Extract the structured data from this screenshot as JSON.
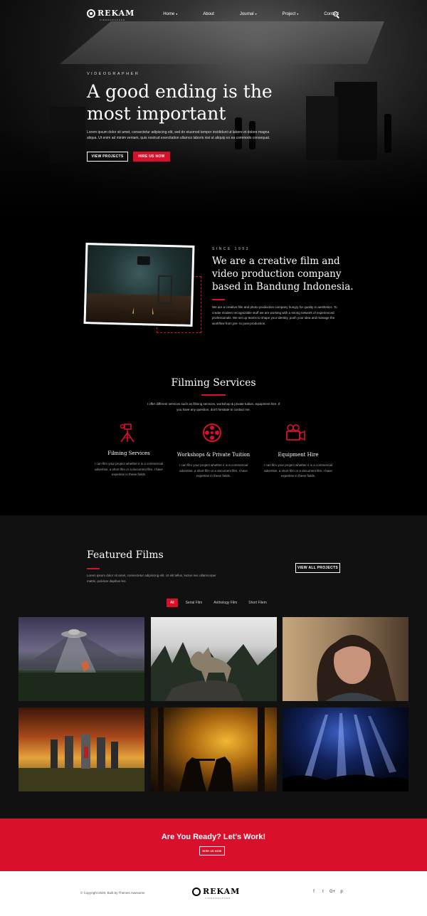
{
  "brand": {
    "name": "REKAM",
    "tagline": "VIDEOGRAPHER"
  },
  "nav": {
    "items": [
      "Home",
      "About",
      "Journal",
      "Project",
      "Contact"
    ],
    "caret": "▾"
  },
  "hero": {
    "eyebrow": "VIDEOGRAPHER",
    "title": "A good ending is the most important",
    "text": "Lorem ipsum dolor sit amet, consectetur adipiscing elit, sed do eiusmod tempor incididunt ut labore et dolore magna aliqua. Ut enim ad minim veniam, quis nostrud exercitation ullamco laboris nisi ut aliquip ex ea commodo consequat.",
    "btn_projects": "VIEW PROJECTS",
    "btn_hire": "HIRE US NOW"
  },
  "about": {
    "since": "SINCE 1993",
    "title": "We are a creative film and video production company based in Bandung Indonesia.",
    "text": "We are a creative film and photo production company hungry for quality in aesthetics. To create modern recognizable stuff we are working with a strong network of experienced professionals. We set up teams to shape your identity, push your idea and manage the workflow from pre- to post-production."
  },
  "services": {
    "title": "Filming Services",
    "subtitle": "I offer different services such as filming services, workshop & private tuition, equipment hire. If you have any question, don't hesitate to contact me.",
    "items": [
      {
        "name": "Filming Services",
        "desc": "I can film your project whether it is a commercial advertise, a short film or a document film. I have expertise in these fields."
      },
      {
        "name": "Workshops & Private Tuition",
        "desc": "I can film your project whether it is a commercial advertise, a short film or a document film. I have expertise in these fields."
      },
      {
        "name": "Equipment Hire",
        "desc": "I can film your project whether it is a commercial advertise, a short film or a document film. I have expertise in these fields."
      }
    ]
  },
  "featured": {
    "title": "Featured Films",
    "text": "Lorem ipsum dolor sit amet, consectetur adipiscing elit. Ut elit tellus, luctus nec ullamcorper mattis, pulvinar dapibus leo.",
    "btn_all": "VIEW ALL PROJECTS",
    "filters": [
      "All",
      "Serial Film",
      "Anthology Film",
      "Short Filem"
    ],
    "active_filter": "All"
  },
  "cta": {
    "title": "Are You Ready? Let's Work!",
    "btn": "HIRE US NOW"
  },
  "footer": {
    "copyright": "© Copyright 2020, Built by Themes Awesome",
    "social": [
      "f",
      "t",
      "G+",
      "p"
    ]
  },
  "colors": {
    "accent": "#d8102b",
    "dark": "#000000",
    "section": "#111111"
  },
  "icons": [
    "search-icon",
    "tripod-icon",
    "film-reel-icon",
    "video-camera-icon",
    "facebook-icon",
    "twitter-icon",
    "google-plus-icon",
    "pinterest-icon"
  ]
}
